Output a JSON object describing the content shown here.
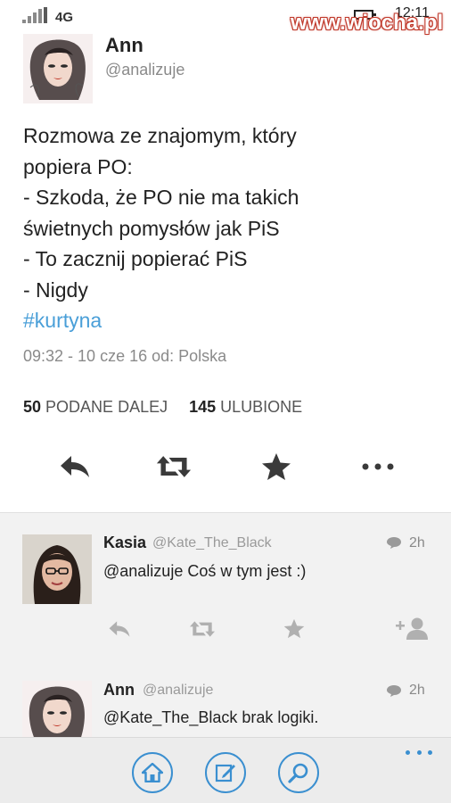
{
  "status_bar": {
    "network": "4G",
    "time": "12:11",
    "watermark": "www.wiocha.pl"
  },
  "tweet": {
    "author_name": "Ann",
    "author_handle": "@analizuje",
    "lines": [
      "Rozmowa ze znajomym, który",
      "popiera PO:",
      "- Szkoda, że PO nie ma takich",
      "świetnych pomysłów jak PiS",
      "- To zacznij popierać PiS",
      "- Nigdy"
    ],
    "hashtag": "#kurtyna",
    "meta": "09:32 - 10 cze 16 od: Polska",
    "retweets_count": "50",
    "retweets_label": "PODANE DALEJ",
    "likes_count": "145",
    "likes_label": "ULUBIONE",
    "actions": [
      "reply-icon",
      "retweet-icon",
      "star-icon",
      "more-icon"
    ]
  },
  "replies": [
    {
      "name": "Kasia",
      "handle": "@Kate_The_Black",
      "time": "2h",
      "text": "@analizuje Coś w tym jest :)",
      "actions": [
        "reply-icon",
        "retweet-icon",
        "star-icon",
        "add-user-icon"
      ]
    },
    {
      "name": "Ann",
      "handle": "@analizuje",
      "time": "2h",
      "text": "@Kate_The_Black brak logiki."
    }
  ],
  "app_bar": {
    "buttons": [
      "home-icon",
      "compose-icon",
      "search-icon",
      "more-icon"
    ]
  },
  "colors": {
    "accent": "#3a8fd0",
    "hashtag": "#4a9fd8",
    "text": "#222222",
    "muted": "#8a8a8a"
  }
}
